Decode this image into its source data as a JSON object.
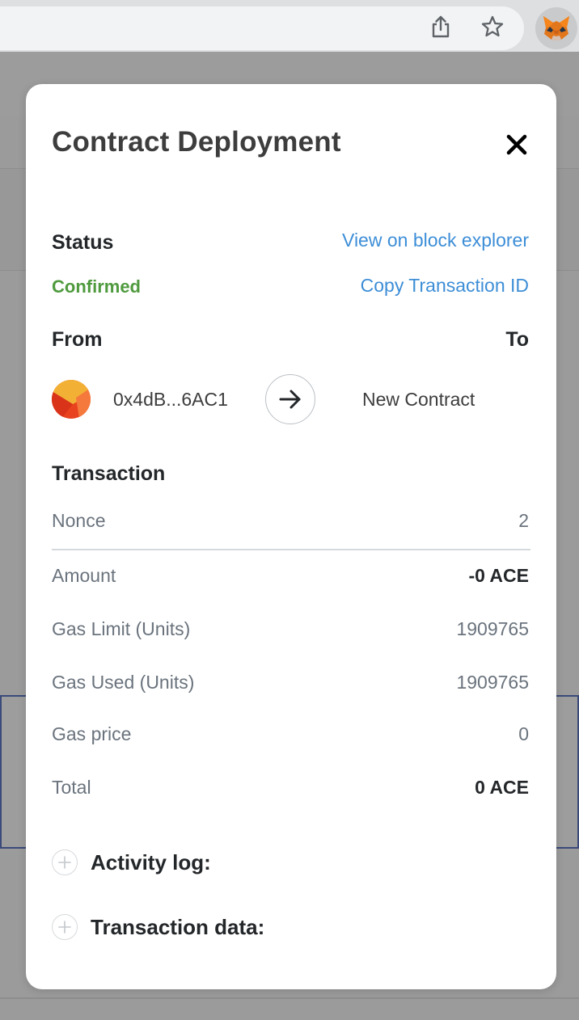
{
  "browser": {
    "icons": [
      "share-icon",
      "bookmark-star-icon",
      "metamask-fox-icon"
    ]
  },
  "modal": {
    "title": "Contract Deployment",
    "status": {
      "label": "Status",
      "value": "Confirmed",
      "value_color": "#4f9a3e",
      "view_link": "View on block explorer",
      "copy_link": "Copy Transaction ID",
      "link_color": "#3d8ed7"
    },
    "from_label": "From",
    "to_label": "To",
    "from_address": "0x4dB...6AC1",
    "to_address": "New Contract",
    "transaction": {
      "heading": "Transaction",
      "rows": [
        {
          "label": "Nonce",
          "value": "2"
        },
        {
          "label": "Amount",
          "value": "-0 ACE"
        },
        {
          "label": "Gas Limit (Units)",
          "value": "1909765"
        },
        {
          "label": "Gas Used (Units)",
          "value": "1909765"
        },
        {
          "label": "Gas price",
          "value": "0"
        },
        {
          "label": "Total",
          "value": "0 ACE"
        }
      ]
    },
    "activity_log_label": "Activity log:",
    "transaction_data_label": "Transaction data:"
  }
}
